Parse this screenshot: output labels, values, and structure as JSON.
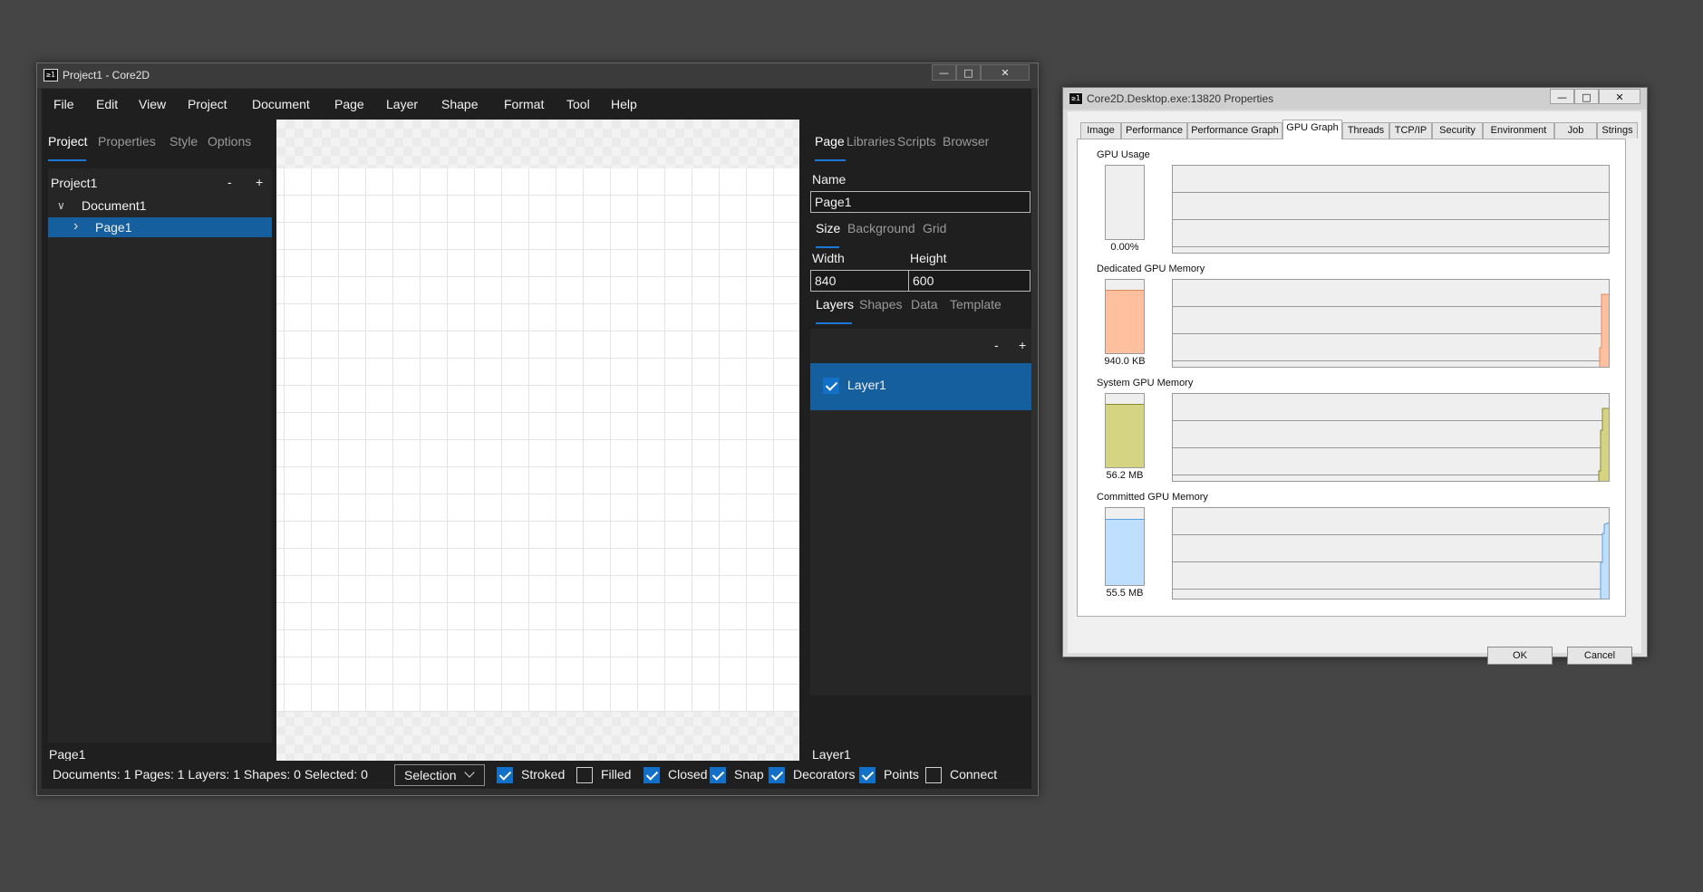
{
  "main_window": {
    "title": "Project1 - Core2D",
    "app_icon": "≥1",
    "controls": {
      "minimize": "—",
      "maximize": "□",
      "close": "✕"
    },
    "menu": [
      "File",
      "Edit",
      "View",
      "Project",
      "Document",
      "Page",
      "Layer",
      "Shape",
      "Format",
      "Tool",
      "Help"
    ],
    "left_tabs": [
      "Project",
      "Properties",
      "Style",
      "Options"
    ],
    "project_header": "Project1",
    "minus": "-",
    "plus": "+",
    "tree": {
      "document": "Document1",
      "page": "Page1"
    },
    "chevron_down": "∨",
    "chevron_right": "›",
    "left_footer": "Page1",
    "right_tabs": [
      "Page",
      "Libraries",
      "Scripts",
      "Browser"
    ],
    "name_label": "Name",
    "name_value": "Page1",
    "size_tabs": [
      "Size",
      "Background",
      "Grid"
    ],
    "width_label": "Width",
    "height_label": "Height",
    "width_value": "840",
    "height_value": "600",
    "layer_tabs": [
      "Layers",
      "Shapes",
      "Data",
      "Template"
    ],
    "layer_item": "Layer1",
    "right_footer": "Layer1",
    "status": {
      "summary": "Documents: 1 Pages: 1 Layers: 1 Shapes: 0 Selected: 0",
      "tool": "Selection",
      "checks": [
        {
          "label": "Stroked",
          "checked": true
        },
        {
          "label": "Filled",
          "checked": false
        },
        {
          "label": "Closed",
          "checked": true
        },
        {
          "label": "Snap",
          "checked": true
        },
        {
          "label": "Decorators",
          "checked": true
        },
        {
          "label": "Points",
          "checked": true
        },
        {
          "label": "Connect",
          "checked": false
        }
      ]
    }
  },
  "properties_window": {
    "title": "Core2D.Desktop.exe:13820 Properties",
    "app_icon": "≥1",
    "controls": {
      "minimize": "—",
      "maximize": "□",
      "close": "✕"
    },
    "tabs": [
      "Image",
      "Performance",
      "Performance Graph",
      "GPU Graph",
      "Threads",
      "TCP/IP",
      "Security",
      "Environment",
      "Job",
      "Strings"
    ],
    "active_tab": "GPU Graph",
    "sections": [
      {
        "label": "GPU Usage",
        "value": "0.00%",
        "level": 0,
        "color": "#efefef",
        "line": "#8a8a8a"
      },
      {
        "label": "Dedicated GPU Memory",
        "value": "940.0 KB",
        "level": 0.85,
        "color": "#ffc0a0",
        "line": "#e08a5a"
      },
      {
        "label": "System GPU Memory",
        "value": "56.2 MB",
        "level": 0.85,
        "color": "#d4d483",
        "line": "#8a8a30"
      },
      {
        "label": "Committed GPU Memory",
        "value": "55.5 MB",
        "level": 0.85,
        "color": "#bfdfff",
        "line": "#5aa0e0"
      }
    ],
    "ok": "OK",
    "cancel": "Cancel"
  }
}
